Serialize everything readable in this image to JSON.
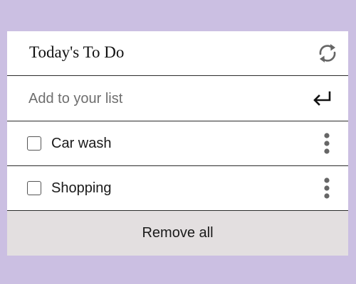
{
  "app": {
    "title": "Today's To Do"
  },
  "header": {
    "refresh_icon": "refresh-icon"
  },
  "add": {
    "placeholder": "Add to your list",
    "value": "",
    "enter_icon": "enter-return-icon"
  },
  "items": [
    {
      "label": "Car wash",
      "checked": false
    },
    {
      "label": "Shopping",
      "checked": false
    }
  ],
  "footer": {
    "remove_all_label": "Remove all"
  },
  "colors": {
    "page_background": "#cbbfe2",
    "card_background": "#ffffff",
    "footer_background": "#e3dfe0",
    "icon_gray": "#666666",
    "divider": "#2b2b2b"
  }
}
